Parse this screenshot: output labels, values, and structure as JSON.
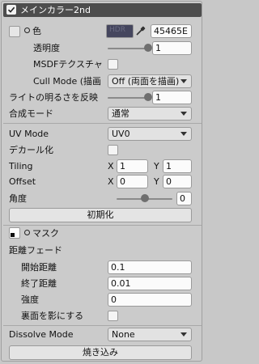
{
  "header": {
    "title": "メインカラー2nd",
    "enabled": true
  },
  "color_row": {
    "label": "色",
    "swatch_text": "HDR",
    "hex": "45465E",
    "swatch_color": "#45465e"
  },
  "opacity": {
    "label": "透明度",
    "value": "1",
    "level": 1.0
  },
  "msdf": {
    "label": "MSDFテクスチャ",
    "checked": false
  },
  "cull_mode": {
    "label": "Cull Mode (描画",
    "value": "Off (両面を描画)"
  },
  "light_intensity": {
    "label": "ライトの明るさを反映",
    "value": "1",
    "level": 1.0
  },
  "blend_mode": {
    "label": "合成モード",
    "value": "通常"
  },
  "uv_mode": {
    "label": "UV Mode",
    "value": "UV0"
  },
  "decal": {
    "label": "デカール化",
    "checked": false
  },
  "tiling": {
    "label": "Tiling",
    "x_label": "X",
    "x": "1",
    "y_label": "Y",
    "y": "1"
  },
  "offset": {
    "label": "Offset",
    "x_label": "X",
    "x": "0",
    "y_label": "Y",
    "y": "0"
  },
  "angle": {
    "label": "角度",
    "value": "0",
    "level": 0.5
  },
  "reset_button": {
    "label": "初期化"
  },
  "mask": {
    "label": "マスク"
  },
  "distance_fade": {
    "label": "距離フェード"
  },
  "fade_start": {
    "label": "開始距離",
    "value": "0.1"
  },
  "fade_end": {
    "label": "終了距離",
    "value": "0.01"
  },
  "strength": {
    "label": "強度",
    "value": "0"
  },
  "backface_shadow": {
    "label": "裏面を影にする",
    "checked": false
  },
  "dissolve": {
    "label": "Dissolve Mode",
    "value": "None"
  },
  "bake_button": {
    "label": "焼き込み"
  }
}
